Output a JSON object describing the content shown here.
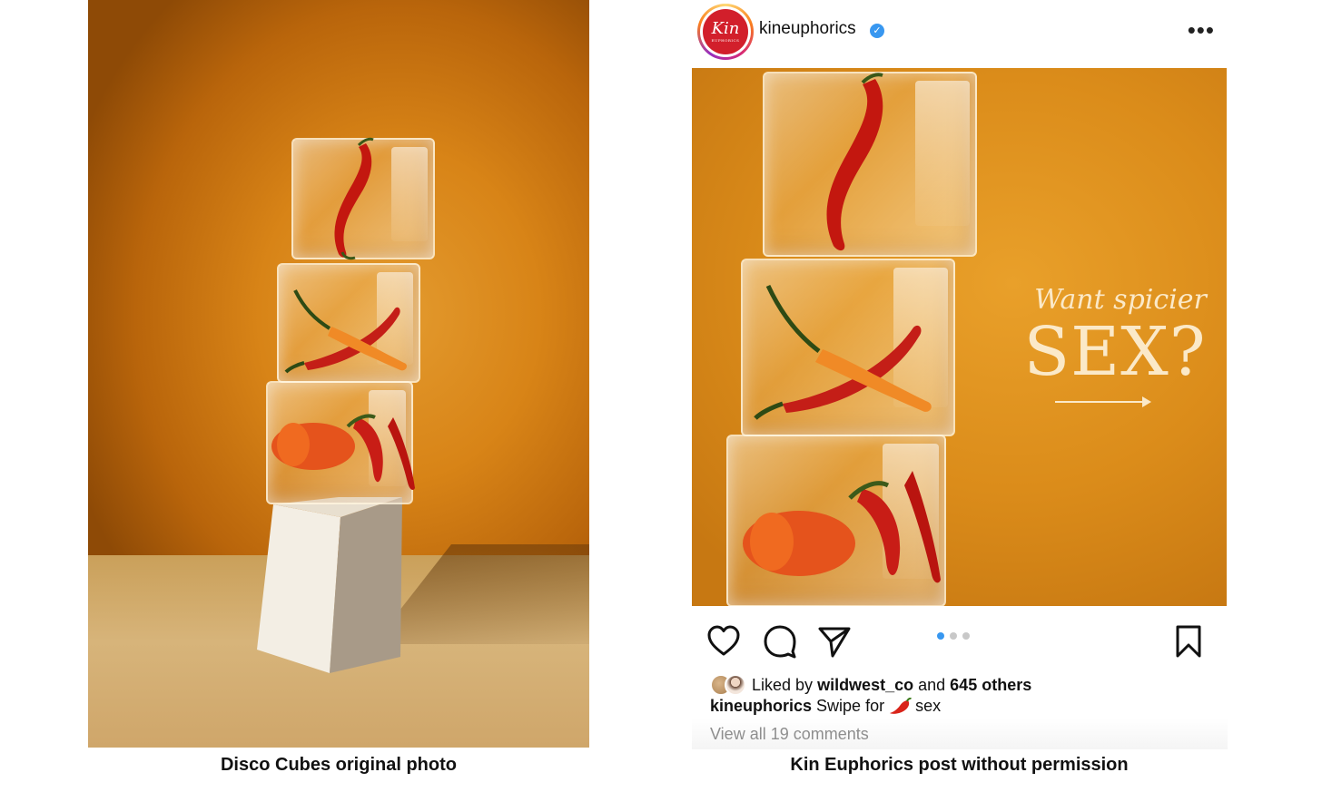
{
  "left_panel": {
    "caption": "Disco Cubes original photo"
  },
  "post": {
    "username": "kineuphorics",
    "avatar_text": "Kin",
    "avatar_subtext": "EUPHORICS",
    "verified_mark": "✓",
    "more_icon": "•••",
    "overlay_line1": "Want spicier",
    "overlay_line2": "SEX?",
    "carousel": {
      "slides": 3,
      "active": 1
    },
    "likes": {
      "prefix": "Liked by",
      "user": "wildwest_co",
      "and": "and",
      "others": "645 others"
    },
    "caption": {
      "user": "kineuphorics",
      "text_before": "Swipe for",
      "emoji_name": "hot-pepper-emoji",
      "text_after": "sex"
    },
    "comments_link": "View all 19 comments",
    "icons": [
      "heart-icon",
      "comment-icon",
      "share-icon",
      "bookmark-icon"
    ],
    "colors": {
      "verified": "#3897f0",
      "active_dot": "#3897f0",
      "overlay_text": "#fbe9c8",
      "brand_red": "#d21f2b"
    }
  },
  "right_panel": {
    "caption": "Kin Euphorics post without permission"
  }
}
